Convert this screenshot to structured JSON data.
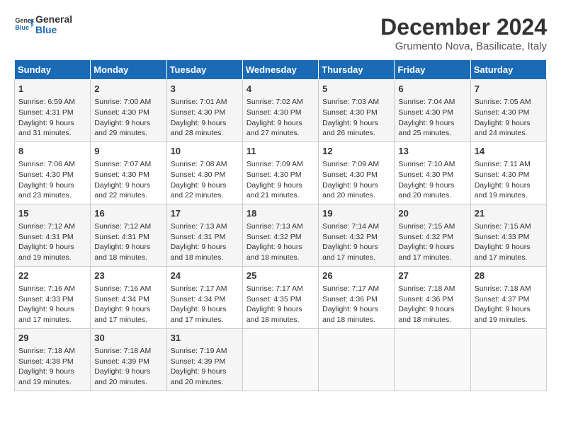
{
  "logo": {
    "line1": "General",
    "line2": "Blue"
  },
  "title": "December 2024",
  "subtitle": "Grumento Nova, Basilicate, Italy",
  "days_of_week": [
    "Sunday",
    "Monday",
    "Tuesday",
    "Wednesday",
    "Thursday",
    "Friday",
    "Saturday"
  ],
  "weeks": [
    [
      {
        "day": 1,
        "sunrise": "6:59 AM",
        "sunset": "4:31 PM",
        "daylight": "9 hours and 31 minutes."
      },
      {
        "day": 2,
        "sunrise": "7:00 AM",
        "sunset": "4:30 PM",
        "daylight": "9 hours and 29 minutes."
      },
      {
        "day": 3,
        "sunrise": "7:01 AM",
        "sunset": "4:30 PM",
        "daylight": "9 hours and 28 minutes."
      },
      {
        "day": 4,
        "sunrise": "7:02 AM",
        "sunset": "4:30 PM",
        "daylight": "9 hours and 27 minutes."
      },
      {
        "day": 5,
        "sunrise": "7:03 AM",
        "sunset": "4:30 PM",
        "daylight": "9 hours and 26 minutes."
      },
      {
        "day": 6,
        "sunrise": "7:04 AM",
        "sunset": "4:30 PM",
        "daylight": "9 hours and 25 minutes."
      },
      {
        "day": 7,
        "sunrise": "7:05 AM",
        "sunset": "4:30 PM",
        "daylight": "9 hours and 24 minutes."
      }
    ],
    [
      {
        "day": 8,
        "sunrise": "7:06 AM",
        "sunset": "4:30 PM",
        "daylight": "9 hours and 23 minutes."
      },
      {
        "day": 9,
        "sunrise": "7:07 AM",
        "sunset": "4:30 PM",
        "daylight": "9 hours and 22 minutes."
      },
      {
        "day": 10,
        "sunrise": "7:08 AM",
        "sunset": "4:30 PM",
        "daylight": "9 hours and 22 minutes."
      },
      {
        "day": 11,
        "sunrise": "7:09 AM",
        "sunset": "4:30 PM",
        "daylight": "9 hours and 21 minutes."
      },
      {
        "day": 12,
        "sunrise": "7:09 AM",
        "sunset": "4:30 PM",
        "daylight": "9 hours and 20 minutes."
      },
      {
        "day": 13,
        "sunrise": "7:10 AM",
        "sunset": "4:30 PM",
        "daylight": "9 hours and 20 minutes."
      },
      {
        "day": 14,
        "sunrise": "7:11 AM",
        "sunset": "4:30 PM",
        "daylight": "9 hours and 19 minutes."
      }
    ],
    [
      {
        "day": 15,
        "sunrise": "7:12 AM",
        "sunset": "4:31 PM",
        "daylight": "9 hours and 19 minutes."
      },
      {
        "day": 16,
        "sunrise": "7:12 AM",
        "sunset": "4:31 PM",
        "daylight": "9 hours and 18 minutes."
      },
      {
        "day": 17,
        "sunrise": "7:13 AM",
        "sunset": "4:31 PM",
        "daylight": "9 hours and 18 minutes."
      },
      {
        "day": 18,
        "sunrise": "7:13 AM",
        "sunset": "4:32 PM",
        "daylight": "9 hours and 18 minutes."
      },
      {
        "day": 19,
        "sunrise": "7:14 AM",
        "sunset": "4:32 PM",
        "daylight": "9 hours and 17 minutes."
      },
      {
        "day": 20,
        "sunrise": "7:15 AM",
        "sunset": "4:32 PM",
        "daylight": "9 hours and 17 minutes."
      },
      {
        "day": 21,
        "sunrise": "7:15 AM",
        "sunset": "4:33 PM",
        "daylight": "9 hours and 17 minutes."
      }
    ],
    [
      {
        "day": 22,
        "sunrise": "7:16 AM",
        "sunset": "4:33 PM",
        "daylight": "9 hours and 17 minutes."
      },
      {
        "day": 23,
        "sunrise": "7:16 AM",
        "sunset": "4:34 PM",
        "daylight": "9 hours and 17 minutes."
      },
      {
        "day": 24,
        "sunrise": "7:17 AM",
        "sunset": "4:34 PM",
        "daylight": "9 hours and 17 minutes."
      },
      {
        "day": 25,
        "sunrise": "7:17 AM",
        "sunset": "4:35 PM",
        "daylight": "9 hours and 18 minutes."
      },
      {
        "day": 26,
        "sunrise": "7:17 AM",
        "sunset": "4:36 PM",
        "daylight": "9 hours and 18 minutes."
      },
      {
        "day": 27,
        "sunrise": "7:18 AM",
        "sunset": "4:36 PM",
        "daylight": "9 hours and 18 minutes."
      },
      {
        "day": 28,
        "sunrise": "7:18 AM",
        "sunset": "4:37 PM",
        "daylight": "9 hours and 19 minutes."
      }
    ],
    [
      {
        "day": 29,
        "sunrise": "7:18 AM",
        "sunset": "4:38 PM",
        "daylight": "9 hours and 19 minutes."
      },
      {
        "day": 30,
        "sunrise": "7:18 AM",
        "sunset": "4:39 PM",
        "daylight": "9 hours and 20 minutes."
      },
      {
        "day": 31,
        "sunrise": "7:19 AM",
        "sunset": "4:39 PM",
        "daylight": "9 hours and 20 minutes."
      },
      null,
      null,
      null,
      null
    ]
  ],
  "labels": {
    "sunrise": "Sunrise:",
    "sunset": "Sunset:",
    "daylight": "Daylight:"
  }
}
